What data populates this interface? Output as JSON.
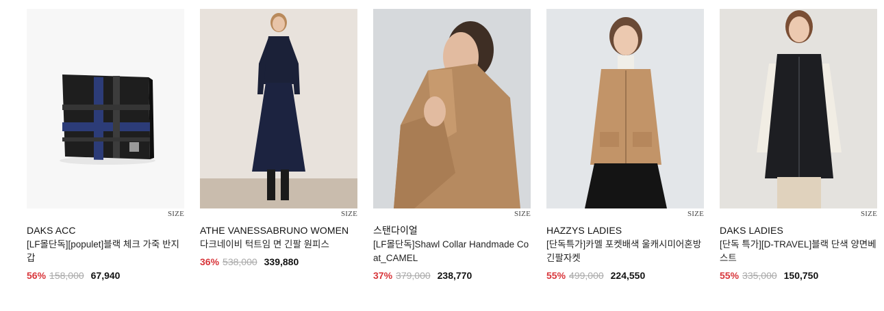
{
  "size_label": "SIZE",
  "products": [
    {
      "brand": "DAKS ACC",
      "name": "[LF몰단독][populet]블랙 체크 가죽 반지갑",
      "discount": "56%",
      "original_price": "158,000",
      "sale_price": "67,940",
      "image": "black-check-leather-wallet"
    },
    {
      "brand": "ATHE VANESSABRUNO WOMEN",
      "name": "다크네이비 턱트임 면 긴팔 원피스",
      "discount": "36%",
      "original_price": "538,000",
      "sale_price": "339,880",
      "image": "model-navy-dress"
    },
    {
      "brand": "스탠다이얼",
      "name": "[LF몰단독]Shawl Collar Handmade Coat_CAMEL",
      "discount": "37%",
      "original_price": "379,000",
      "sale_price": "238,770",
      "image": "model-camel-coat"
    },
    {
      "brand": "HAZZYS LADIES",
      "name": "[단독특가]카멜 포켓배색 울캐시미어혼방 긴팔자켓",
      "discount": "55%",
      "original_price": "499,000",
      "sale_price": "224,550",
      "image": "model-camel-jacket"
    },
    {
      "brand": "DAKS LADIES",
      "name": "[단독 특가][D-TRAVEL]블랙 단색 양면베스트",
      "discount": "55%",
      "original_price": "335,000",
      "sale_price": "150,750",
      "image": "model-black-vest"
    }
  ]
}
